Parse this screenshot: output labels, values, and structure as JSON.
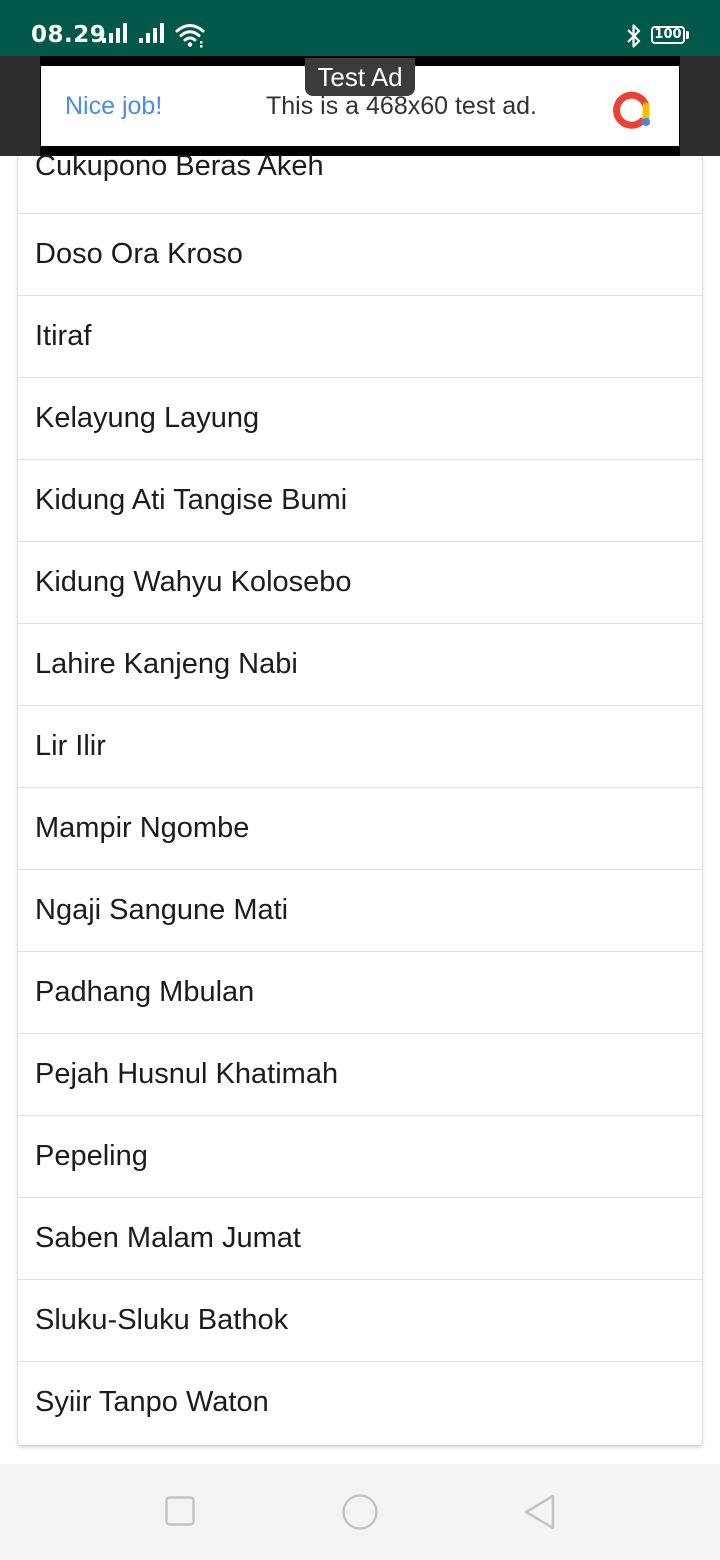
{
  "status_bar": {
    "time": "08.29",
    "battery": "100",
    "background": "#02594a",
    "icons": [
      "signal-icon",
      "signal-icon",
      "wifi-icon",
      "bluetooth-icon",
      "battery-icon"
    ]
  },
  "ad": {
    "badge": "Test Ad",
    "cta": "Nice job!",
    "text": "This is a 468x60 test ad.",
    "logo": "admob-logo-icon"
  },
  "list": {
    "items": [
      "Cukupono Beras Akeh",
      "Doso Ora Kroso",
      "Itiraf",
      "Kelayung Layung",
      "Kidung Ati Tangise Bumi",
      "Kidung Wahyu Kolosebo",
      "Lahire Kanjeng Nabi",
      "Lir Ilir",
      "Mampir Ngombe",
      "Ngaji Sangune Mati",
      "Padhang Mbulan",
      "Pejah Husnul Khatimah",
      "Pepeling",
      "Saben Malam Jumat",
      "Sluku-Sluku Bathok",
      "Syiir Tanpo Waton"
    ]
  },
  "nav_bar": {
    "buttons": [
      "recent-apps-icon",
      "home-icon",
      "back-icon"
    ]
  }
}
